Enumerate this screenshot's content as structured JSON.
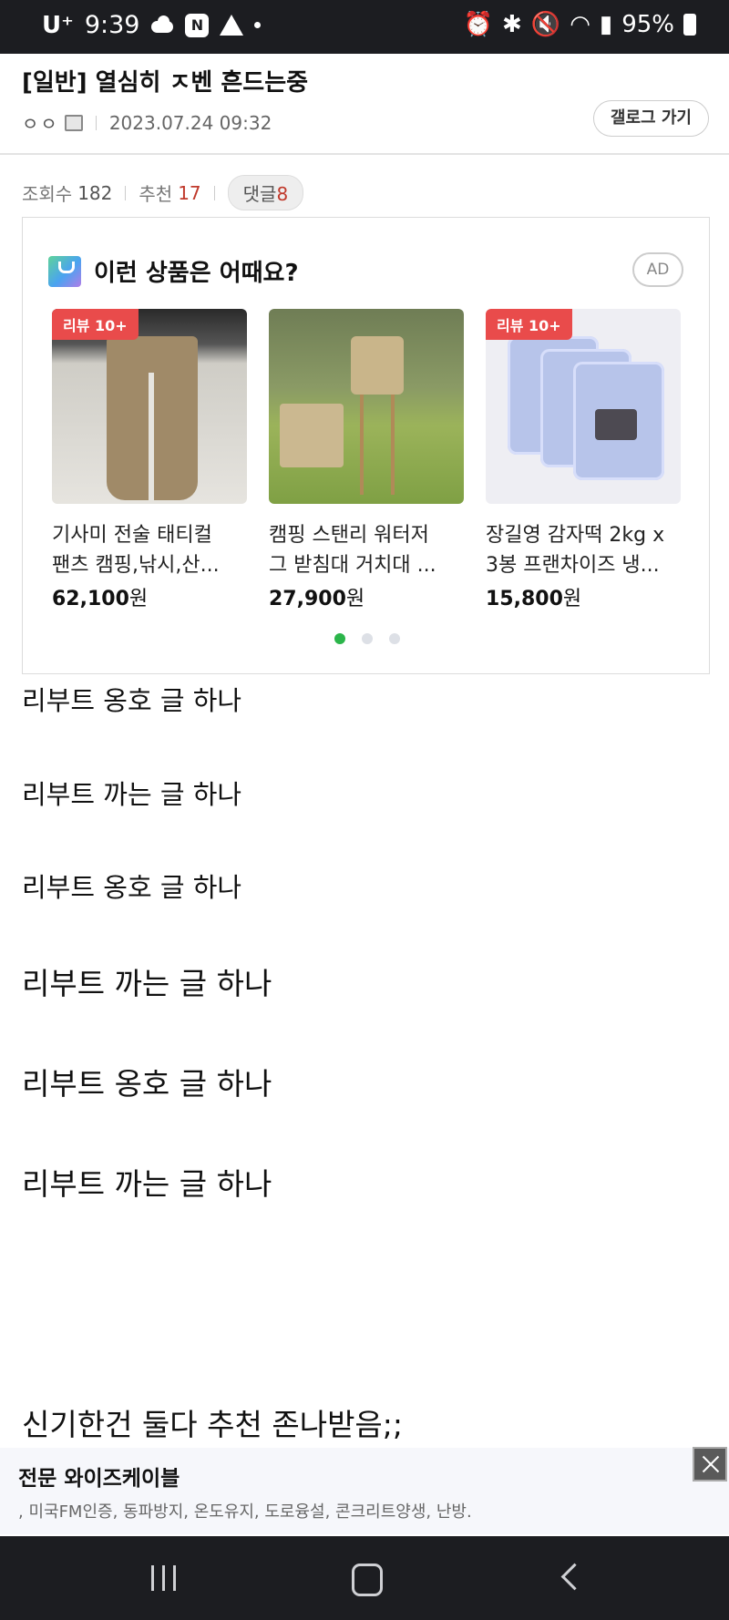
{
  "status_bar": {
    "carrier": "U⁺",
    "time": "9:39",
    "battery": "95%",
    "icons": [
      "cloud-icon",
      "n-badge-icon",
      "warning-icon",
      "dot-icon",
      "alarm-icon",
      "bluetooth-icon",
      "mute-icon",
      "wifi-icon",
      "signal-icon",
      "battery-icon"
    ]
  },
  "post": {
    "title": "[일반] 열심히 ㅈ벤 흔드는중",
    "author": "ㅇㅇ",
    "datetime": "2023.07.24 09:32",
    "gallog_button": "갤로그 가기"
  },
  "stats": {
    "views_label": "조회수",
    "views": "182",
    "recommend_label": "추천",
    "recommend": "17",
    "comments_label": "댓글",
    "comments": "8"
  },
  "ad_box": {
    "heading": "이런 상품은 어때요?",
    "ad_label": "AD",
    "products": [
      {
        "tag": "리뷰 10+",
        "name_line1": "기사미 전술 태티컬",
        "name_line2": "팬츠 캠핑,낚시,산...",
        "price": "62,100",
        "currency": "원"
      },
      {
        "tag": "",
        "name_line1": "캠핑 스탠리 워터저",
        "name_line2": "그 받침대 거치대 ...",
        "price": "27,900",
        "currency": "원"
      },
      {
        "tag": "리뷰 10+",
        "name_line1": "장길영 감자떡 2kg x",
        "name_line2": "3봉 프랜차이즈 냉...",
        "price": "15,800",
        "currency": "원"
      }
    ],
    "pager_active_color": "#2bb54a"
  },
  "body_lines": [
    "리부트 옹호 글 하나",
    "리부트 까는 글 하나",
    "리부트 옹호 글 하나",
    "리부트 까는 글 하나",
    "리부트 옹호 글 하나",
    "리부트 까는 글 하나",
    "신기한건 둘다 추천 존나받음;;"
  ],
  "banner": {
    "title": "전문 와이즈케이블",
    "description": ", 미국FM인증, 동파방지, 온도유지, 도로융설, 콘크리트양생, 난방."
  }
}
